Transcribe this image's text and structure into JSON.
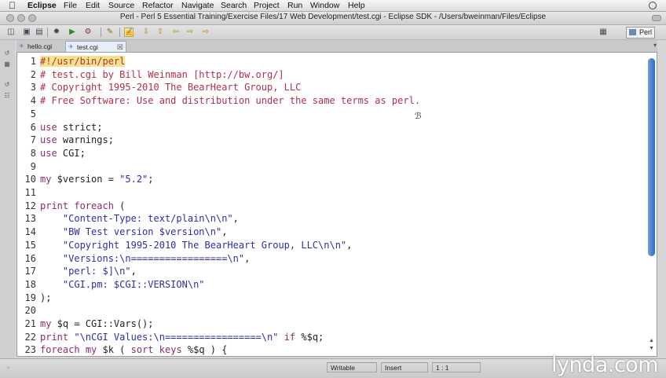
{
  "menubar": {
    "apple": "",
    "app": "Eclipse",
    "items": [
      "File",
      "Edit",
      "Source",
      "Refactor",
      "Navigate",
      "Search",
      "Project",
      "Run",
      "Window",
      "Help"
    ]
  },
  "window": {
    "title": "Perl - Perl 5 Essential Training/Exercise Files/17 Web Development/test.cgi - Eclipse SDK - /Users/bweinman/Files/Eclipse"
  },
  "toolbar": {
    "perspective_label": "Perl",
    "icons": [
      "new-icon",
      "save-icon",
      "print-icon",
      "debug-icon",
      "run-icon",
      "external-tools-icon",
      "open-type-icon",
      "mark-occurrences-icon",
      "next-annotation-icon",
      "prev-annotation-icon",
      "back-icon",
      "forward-icon"
    ]
  },
  "tabs": [
    {
      "label": "hello.cgi",
      "active": false
    },
    {
      "label": "test.cgi",
      "active": true,
      "close": "☒"
    }
  ],
  "tabs_overflow": "▾",
  "code": {
    "lines": [
      {
        "n": "1",
        "segs": [
          {
            "t": "#!/usr/bin/perl",
            "c": "c shebang"
          }
        ]
      },
      {
        "n": "2",
        "segs": [
          {
            "t": "# test.cgi by Bill Weinman [http://bw.org/]",
            "c": "c"
          }
        ]
      },
      {
        "n": "3",
        "segs": [
          {
            "t": "# Copyright 1995-2010 The BearHeart Group, LLC",
            "c": "c"
          }
        ]
      },
      {
        "n": "4",
        "segs": [
          {
            "t": "# Free Software: Use and distribution under the same terms as perl.",
            "c": "c"
          }
        ]
      },
      {
        "n": "5",
        "segs": []
      },
      {
        "n": "6",
        "segs": [
          {
            "t": "use",
            "c": "k"
          },
          {
            "t": " strict;",
            "c": ""
          }
        ]
      },
      {
        "n": "7",
        "segs": [
          {
            "t": "use",
            "c": "k"
          },
          {
            "t": " warnings;",
            "c": ""
          }
        ]
      },
      {
        "n": "8",
        "segs": [
          {
            "t": "use",
            "c": "k"
          },
          {
            "t": " CGI;",
            "c": ""
          }
        ]
      },
      {
        "n": "9",
        "segs": []
      },
      {
        "n": "10",
        "segs": [
          {
            "t": "my",
            "c": "k"
          },
          {
            "t": " $version = ",
            "c": ""
          },
          {
            "t": "\"5.2\"",
            "c": "s"
          },
          {
            "t": ";",
            "c": ""
          }
        ]
      },
      {
        "n": "11",
        "segs": []
      },
      {
        "n": "12",
        "segs": [
          {
            "t": "print",
            "c": "k"
          },
          {
            "t": " ",
            "c": ""
          },
          {
            "t": "foreach",
            "c": "k"
          },
          {
            "t": " (",
            "c": ""
          }
        ]
      },
      {
        "n": "13",
        "segs": [
          {
            "t": "    ",
            "c": ""
          },
          {
            "t": "\"Content-Type: text/plain\\n\\n\"",
            "c": "s"
          },
          {
            "t": ",",
            "c": ""
          }
        ]
      },
      {
        "n": "14",
        "segs": [
          {
            "t": "    ",
            "c": ""
          },
          {
            "t": "\"BW Test version $version\\n\"",
            "c": "s"
          },
          {
            "t": ",",
            "c": ""
          }
        ]
      },
      {
        "n": "15",
        "segs": [
          {
            "t": "    ",
            "c": ""
          },
          {
            "t": "\"Copyright 1995-2010 The BearHeart Group, LLC\\n\\n\"",
            "c": "s"
          },
          {
            "t": ",",
            "c": ""
          }
        ]
      },
      {
        "n": "16",
        "segs": [
          {
            "t": "    ",
            "c": ""
          },
          {
            "t": "\"Versions:\\n=================\\n\"",
            "c": "s"
          },
          {
            "t": ",",
            "c": ""
          }
        ]
      },
      {
        "n": "17",
        "segs": [
          {
            "t": "    ",
            "c": ""
          },
          {
            "t": "\"perl: $]\\n\"",
            "c": "s"
          },
          {
            "t": ",",
            "c": ""
          }
        ]
      },
      {
        "n": "18",
        "segs": [
          {
            "t": "    ",
            "c": ""
          },
          {
            "t": "\"CGI.pm: $CGI::VERSION\\n\"",
            "c": "s"
          }
        ]
      },
      {
        "n": "19",
        "segs": [
          {
            "t": ");",
            "c": ""
          }
        ]
      },
      {
        "n": "20",
        "segs": []
      },
      {
        "n": "21",
        "segs": [
          {
            "t": "my",
            "c": "k"
          },
          {
            "t": " $q = CGI::Vars();",
            "c": ""
          }
        ]
      },
      {
        "n": "22",
        "segs": [
          {
            "t": "print",
            "c": "k"
          },
          {
            "t": " ",
            "c": ""
          },
          {
            "t": "\"\\nCGI Values:\\n=================\\n\"",
            "c": "s"
          },
          {
            "t": " ",
            "c": ""
          },
          {
            "t": "if",
            "c": "k"
          },
          {
            "t": " %$q;",
            "c": ""
          }
        ]
      },
      {
        "n": "23",
        "segs": [
          {
            "t": "foreach",
            "c": "k"
          },
          {
            "t": " ",
            "c": ""
          },
          {
            "t": "my",
            "c": "k"
          },
          {
            "t": " $k ( ",
            "c": ""
          },
          {
            "t": "sort",
            "c": "k"
          },
          {
            "t": " ",
            "c": ""
          },
          {
            "t": "keys",
            "c": "k"
          },
          {
            "t": " %$q ) {",
            "c": ""
          }
        ]
      }
    ]
  },
  "status": {
    "mode": "Writable",
    "insert": "Insert",
    "position": "1 : 1"
  },
  "watermark": "lynda.com",
  "colors": {
    "comment": "#b03048",
    "keyword": "#8c2a6e",
    "string": "#2c2ca8",
    "shebang_highlight": "#f4e38a",
    "scroll_thumb": "#2e6cc8"
  }
}
